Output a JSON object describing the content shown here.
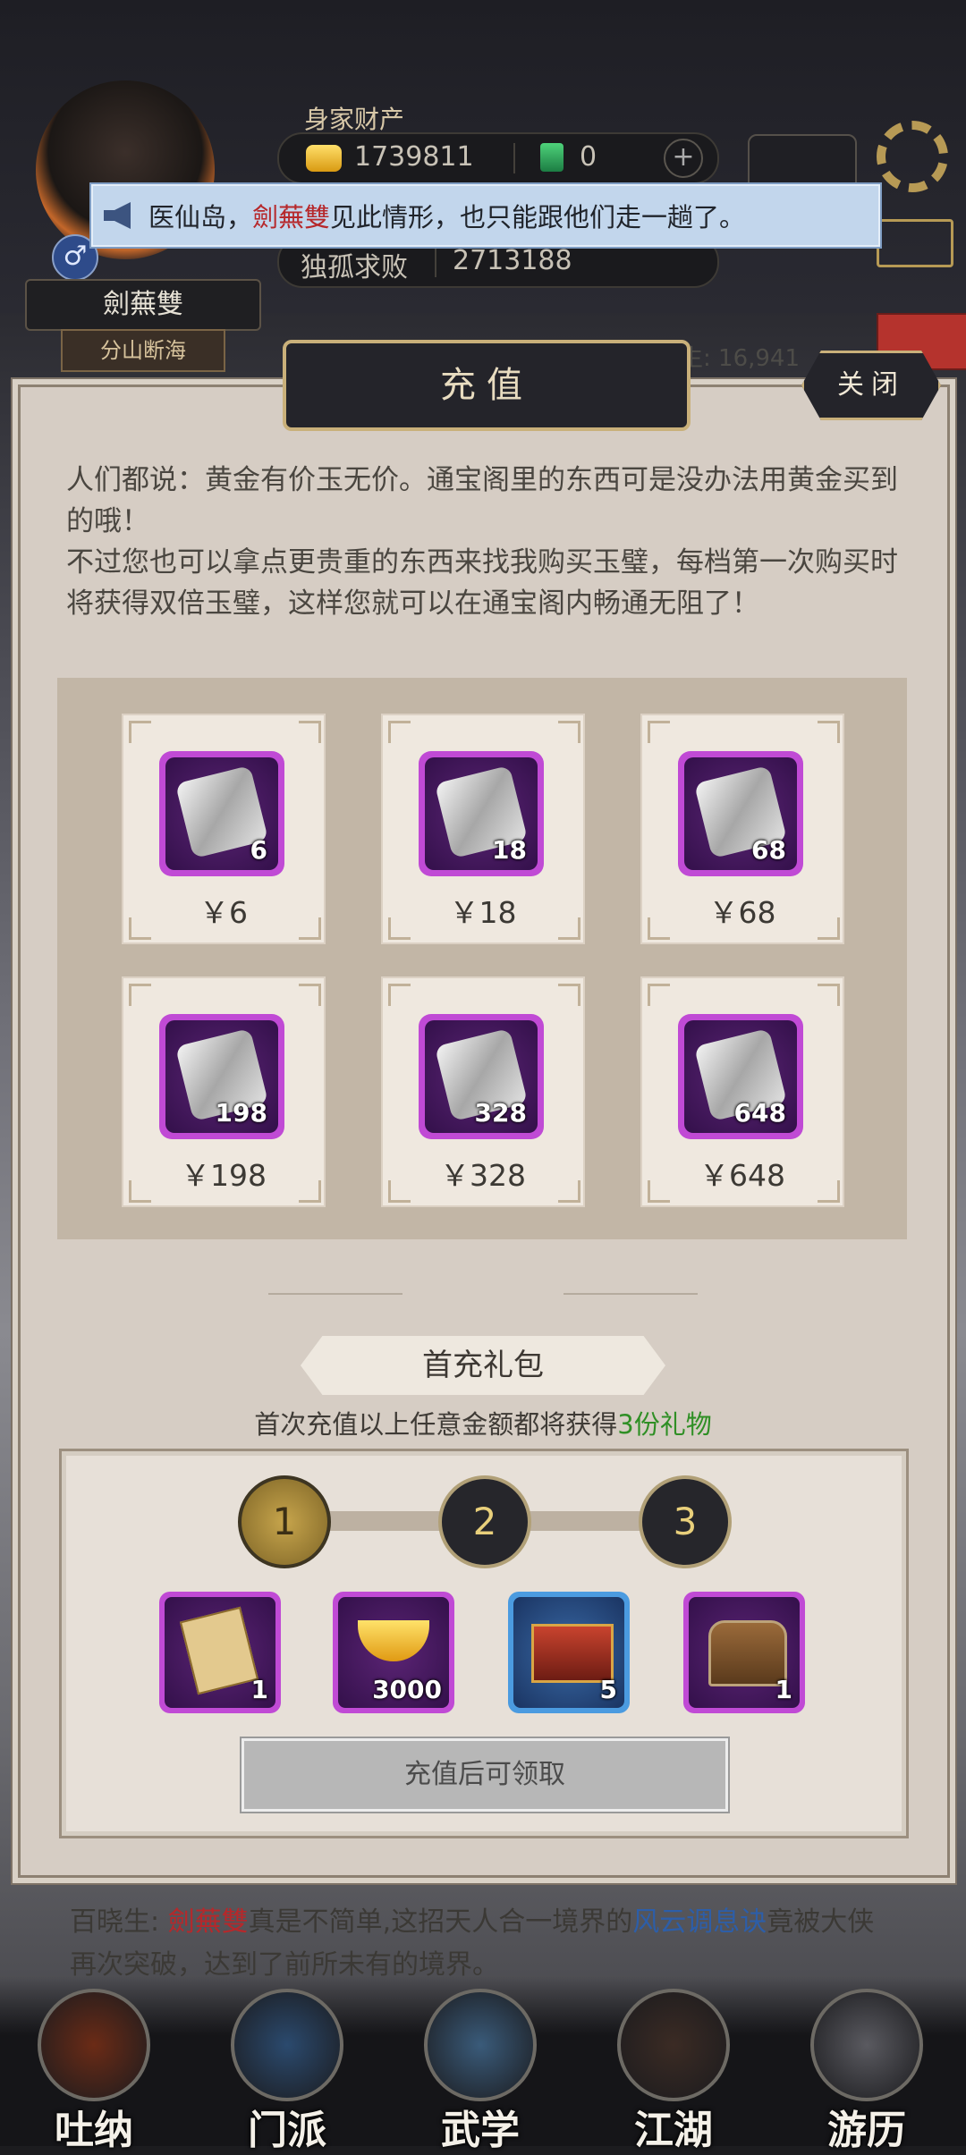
{
  "player": {
    "name": "劍蕪雙",
    "title": "分山断海",
    "gender_symbol": "♂"
  },
  "wealth": {
    "label": "身家财产",
    "coins": "1739811",
    "jade": "0",
    "rival_name": "独孤求败",
    "rival_value": "2713188",
    "plus": "+"
  },
  "topright_count": "生: 16,941",
  "notice": {
    "prefix": "医仙岛，",
    "highlight": "劍蕪雙",
    "suffix": "见此情形，也只能跟他们走一趟了。"
  },
  "dialog": {
    "title": "充值",
    "close_label": "关闭",
    "intro": "人们都说：黄金有价玉无价。通宝阁里的东西可是没办法用黄金买到的哦！\n不过您也可以拿点更贵重的东西来找我购买玉璧，每档第一次购买时将获得双倍玉璧，这样您就可以在通宝阁内畅通无阻了！"
  },
  "packs": [
    {
      "qty": "6",
      "price": "￥6"
    },
    {
      "qty": "18",
      "price": "￥18"
    },
    {
      "qty": "68",
      "price": "￥68"
    },
    {
      "qty": "198",
      "price": "￥198"
    },
    {
      "qty": "328",
      "price": "￥328"
    },
    {
      "qty": "648",
      "price": "￥648"
    }
  ],
  "first_recharge": {
    "tab_label": "首充礼包",
    "desc_prefix": "首次充值以上任意金额都将获得",
    "desc_highlight": "3份礼物",
    "steps": [
      "1",
      "2",
      "3"
    ],
    "rewards": [
      {
        "icon": "book-icon",
        "qty": "1"
      },
      {
        "icon": "gold-ingot-icon",
        "qty": "3000"
      },
      {
        "icon": "red-chest-icon",
        "qty": "5"
      },
      {
        "icon": "wooden-chest-icon",
        "qty": "1"
      }
    ],
    "claim_label": "充值后可领取"
  },
  "chat": {
    "speaker": "百晓生:",
    "name": "劍蕪雙",
    "mid": "真是不简单,这招天人合一境界的",
    "skill": "风云调息诀",
    "end": "竟被大侠再次突破，达到了前所未有的境界。"
  },
  "nav": [
    {
      "label": "吐纳",
      "icon": "meditation-icon"
    },
    {
      "label": "门派",
      "icon": "sect-icon"
    },
    {
      "label": "武学",
      "icon": "martial-arts-icon"
    },
    {
      "label": "江湖",
      "icon": "jianghu-icon"
    },
    {
      "label": "游历",
      "icon": "travel-icon"
    }
  ],
  "colors": {
    "accent_gold": "#c9b07a",
    "highlight_red": "#b6282b",
    "highlight_green": "#2f8f25",
    "pack_purple": "#c04ad5"
  }
}
